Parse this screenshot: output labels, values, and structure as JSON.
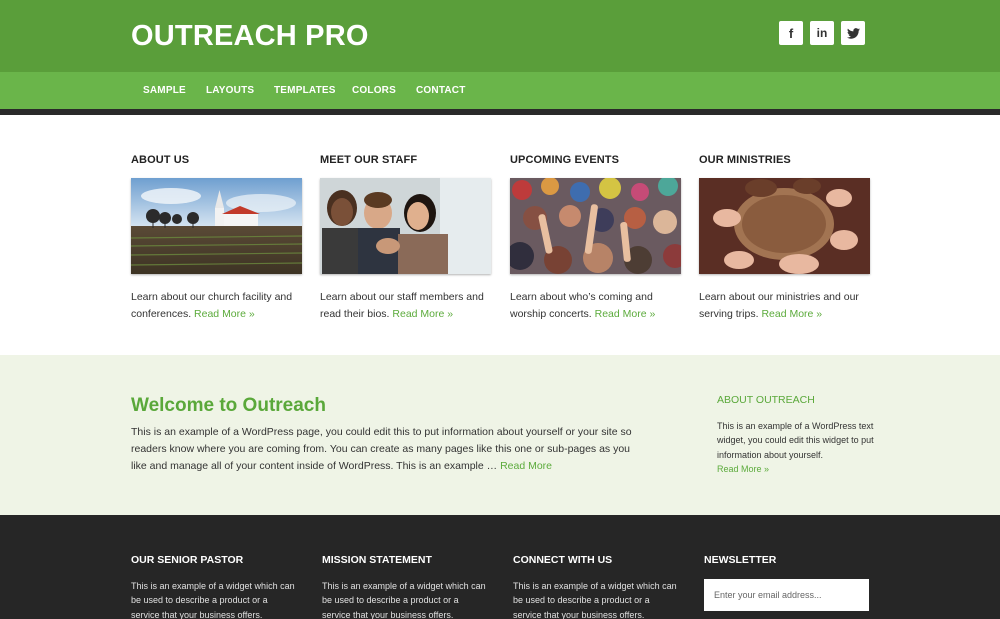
{
  "header": {
    "site_title": "OUTREACH PRO",
    "social": [
      {
        "name": "facebook-icon",
        "glyph": "f"
      },
      {
        "name": "linkedin-icon",
        "glyph": "in"
      },
      {
        "name": "twitter-icon",
        "glyph": "🐦"
      }
    ]
  },
  "nav": {
    "items": [
      "SAMPLE",
      "LAYOUTS",
      "TEMPLATES",
      "COLORS",
      "CONTACT"
    ]
  },
  "features": [
    {
      "title": "ABOUT US",
      "text": "Learn about our church facility and conferences.",
      "link": "Read More »"
    },
    {
      "title": "MEET OUR STAFF",
      "text": "Learn about our staff members and read their bios.",
      "link": "Read More »"
    },
    {
      "title": "UPCOMING EVENTS",
      "text": "Learn about who’s coming and worship concerts.",
      "link": "Read More »"
    },
    {
      "title": "OUR MINISTRIES",
      "text": "Learn about our ministries and our serving trips.",
      "link": "Read More »"
    }
  ],
  "welcome": {
    "title": "Welcome to Outreach",
    "text": "This is an example of a WordPress page, you could edit this to put information about yourself or your site so readers know where you are coming from. You can create as many pages like this one or sub-pages as you like and manage all of your content inside of WordPress. This is an example …",
    "link": "Read More"
  },
  "sidebar": {
    "title": "ABOUT OUTREACH",
    "text": "This is an example of a WordPress text widget, you could edit this widget to put information about yourself.",
    "link": "Read More »"
  },
  "footer": {
    "widgets": [
      {
        "title": "OUR SENIOR PASTOR",
        "text": "This is an example of a widget which can be used to describe a product or a service that your business offers."
      },
      {
        "title": "MISSION STATEMENT",
        "text": "This is an example of a widget which can be used to describe a product or a service that your business offers."
      },
      {
        "title": "CONNECT WITH US",
        "text": "This is an example of a widget which can be used to describe a product or a service that your business offers."
      }
    ],
    "newsletter": {
      "title": "NEWSLETTER",
      "placeholder": "Enter your email address..."
    }
  },
  "colors": {
    "header_green": "#5a9e3a",
    "nav_green": "#6ab54a",
    "link_green": "#5cab3c",
    "band_bg": "#eff4e6",
    "footer_bg": "#262626"
  }
}
